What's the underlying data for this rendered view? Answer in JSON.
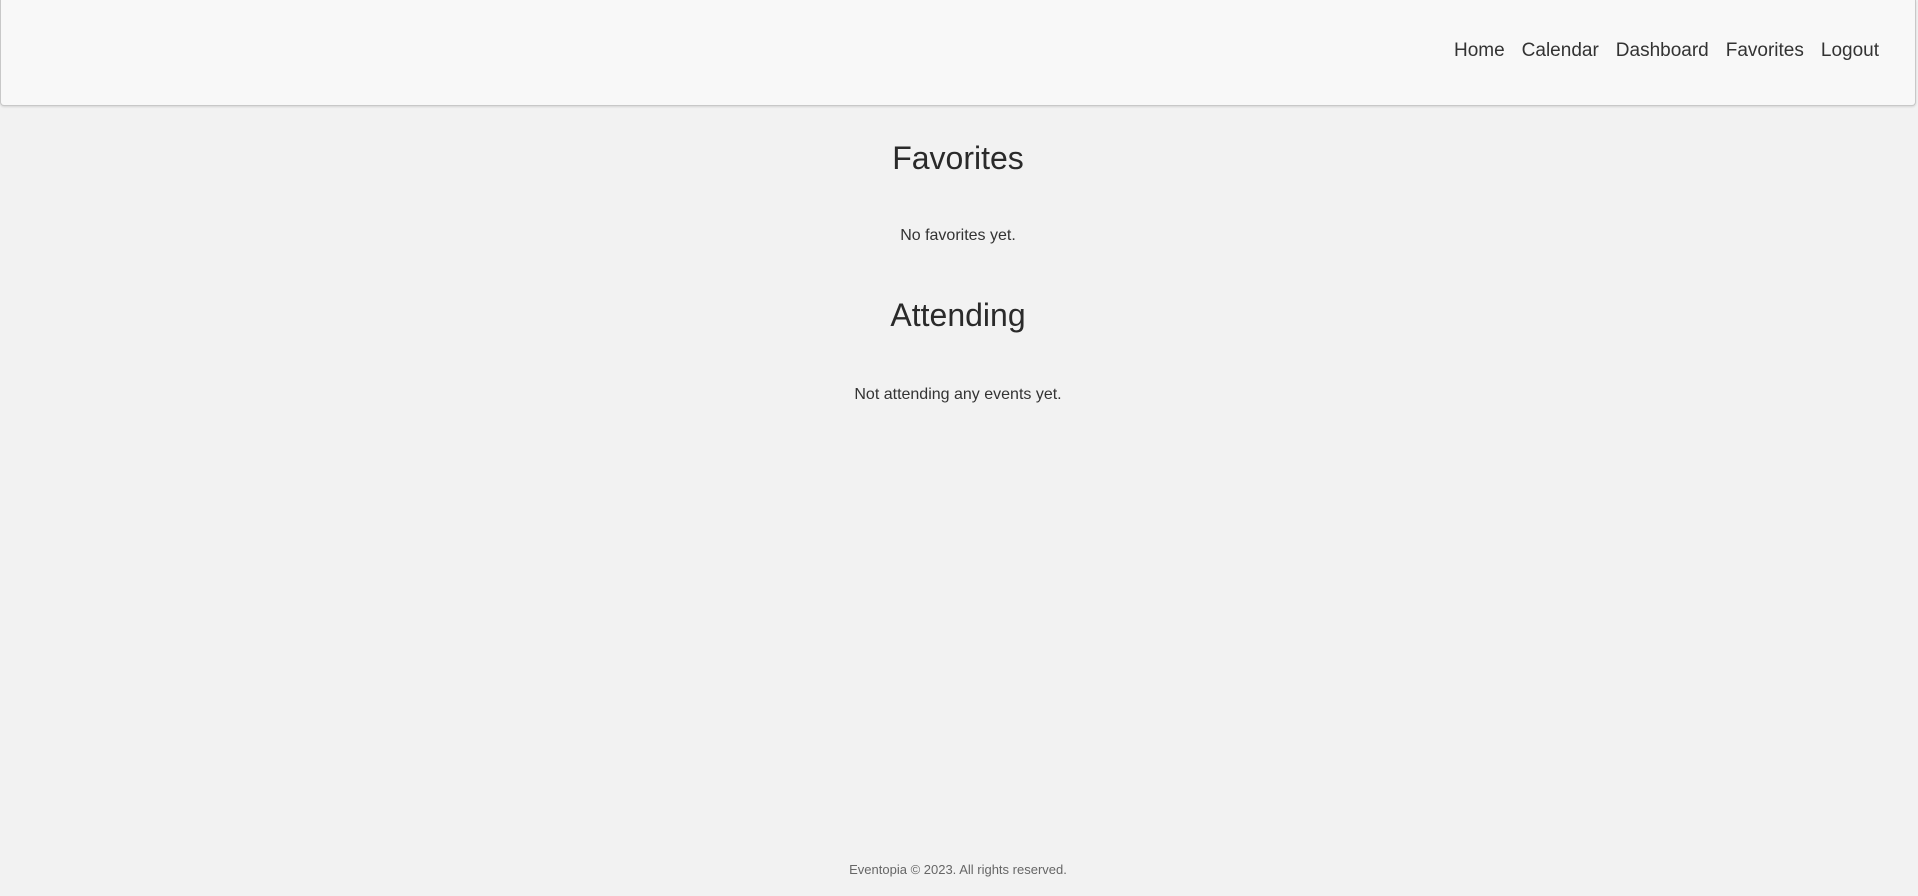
{
  "nav": {
    "items": [
      {
        "label": "Home"
      },
      {
        "label": "Calendar"
      },
      {
        "label": "Dashboard"
      },
      {
        "label": "Favorites"
      },
      {
        "label": "Logout"
      }
    ]
  },
  "favorites": {
    "title": "Favorites",
    "empty_text": "No favorites yet."
  },
  "attending": {
    "title": "Attending",
    "empty_text": "Not attending any events yet."
  },
  "footer": {
    "text": "Eventopia © 2023. All rights reserved."
  },
  "colors": {
    "background": "#f2f2f2",
    "navbar_background": "#f8f8f8",
    "text": "#333333"
  }
}
